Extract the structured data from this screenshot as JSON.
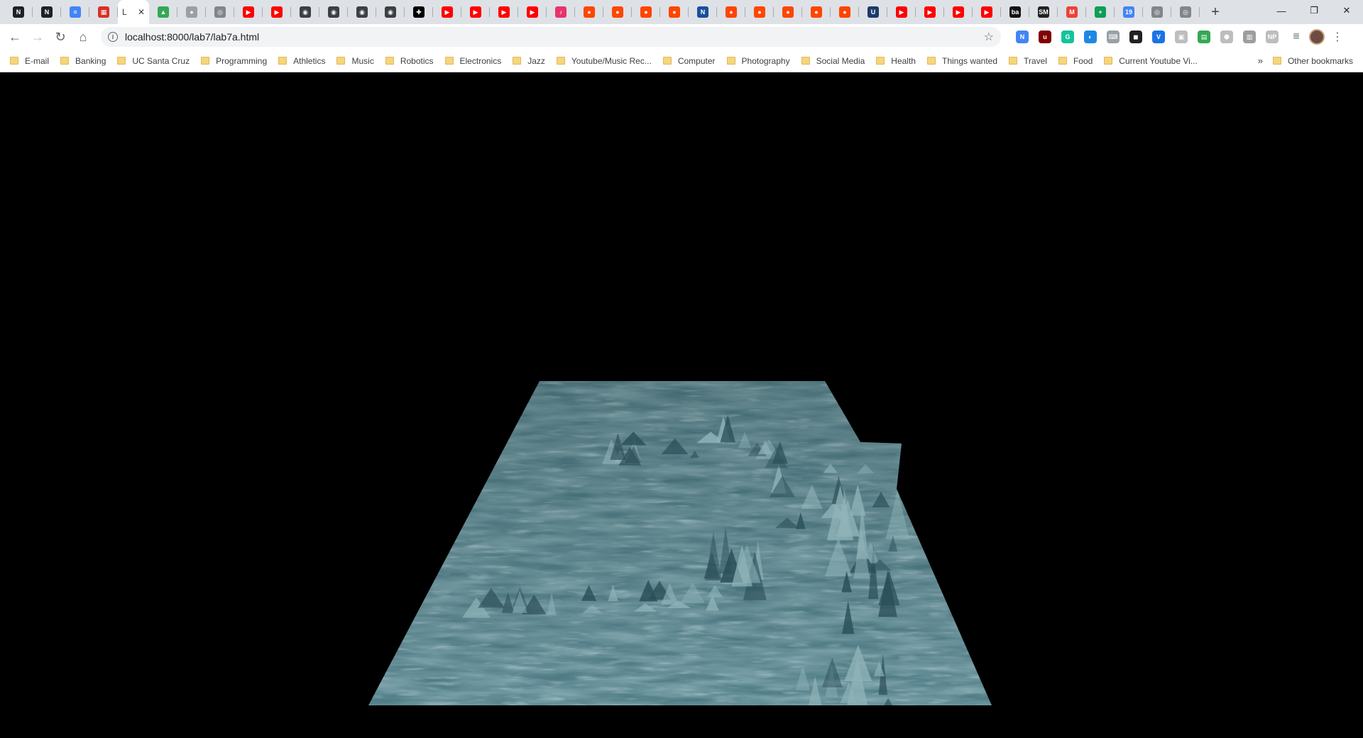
{
  "tabs": [
    {
      "icon": "notion-icon",
      "color": "#202124",
      "glyph": "N"
    },
    {
      "icon": "notion-icon",
      "color": "#202124",
      "glyph": "N"
    },
    {
      "icon": "docs-icon",
      "color": "#4285f4",
      "glyph": "≡"
    },
    {
      "icon": "calendar-icon",
      "color": "#d93025",
      "glyph": "▦"
    },
    {
      "active": true,
      "label": "L",
      "close": "✕"
    },
    {
      "icon": "drive-icon",
      "color": "#34a853",
      "glyph": "▲"
    },
    {
      "icon": "github-icon",
      "color": "#9aa0a6",
      "glyph": "●"
    },
    {
      "icon": "globe-icon",
      "color": "#80868b",
      "glyph": "◎"
    },
    {
      "icon": "youtube-icon",
      "color": "#ff0000",
      "glyph": "▶"
    },
    {
      "icon": "youtube-icon",
      "color": "#ff0000",
      "glyph": "▶"
    },
    {
      "icon": "camera-icon",
      "color": "#3c4043",
      "glyph": "◉"
    },
    {
      "icon": "camera-icon",
      "color": "#3c4043",
      "glyph": "◉"
    },
    {
      "icon": "camera-icon",
      "color": "#3c4043",
      "glyph": "◉"
    },
    {
      "icon": "camera-icon",
      "color": "#3c4043",
      "glyph": "◉"
    },
    {
      "icon": "plus-icon",
      "color": "#000000",
      "glyph": "✚"
    },
    {
      "icon": "youtube-icon",
      "color": "#ff0000",
      "glyph": "▶"
    },
    {
      "icon": "youtube-icon",
      "color": "#ff0000",
      "glyph": "▶"
    },
    {
      "icon": "youtube-icon",
      "color": "#ff0000",
      "glyph": "▶"
    },
    {
      "icon": "youtube-icon",
      "color": "#ff0000",
      "glyph": "▶"
    },
    {
      "icon": "music-icon",
      "color": "#e8336d",
      "glyph": "♪"
    },
    {
      "icon": "reddit-icon",
      "color": "#ff4500",
      "glyph": "●"
    },
    {
      "icon": "reddit-icon",
      "color": "#ff4500",
      "glyph": "●"
    },
    {
      "icon": "reddit-icon",
      "color": "#ff4500",
      "glyph": "●"
    },
    {
      "icon": "reddit-icon",
      "color": "#ff4500",
      "glyph": "●"
    },
    {
      "icon": "news-icon",
      "color": "#1a4f9c",
      "glyph": "N"
    },
    {
      "icon": "reddit-icon",
      "color": "#ff4500",
      "glyph": "●"
    },
    {
      "icon": "reddit-icon",
      "color": "#ff4500",
      "glyph": "●"
    },
    {
      "icon": "reddit-icon",
      "color": "#ff4500",
      "glyph": "●"
    },
    {
      "icon": "reddit-icon",
      "color": "#ff4500",
      "glyph": "●"
    },
    {
      "icon": "reddit-icon",
      "color": "#ff4500",
      "glyph": "●"
    },
    {
      "icon": "ucsc-icon",
      "color": "#1b3a6b",
      "glyph": "U"
    },
    {
      "icon": "youtube-icon",
      "color": "#ff0000",
      "glyph": "▶"
    },
    {
      "icon": "youtube-icon",
      "color": "#ff0000",
      "glyph": "▶"
    },
    {
      "icon": "youtube-icon",
      "color": "#ff0000",
      "glyph": "▶"
    },
    {
      "icon": "youtube-icon",
      "color": "#ff0000",
      "glyph": "▶"
    },
    {
      "icon": "behance-icon",
      "color": "#111111",
      "glyph": "ba"
    },
    {
      "icon": "sm-icon",
      "color": "#222222",
      "glyph": "SM"
    },
    {
      "icon": "gmail-icon",
      "color": "#ea4335",
      "glyph": "M"
    },
    {
      "icon": "sheets-plus-icon",
      "color": "#0f9d58",
      "glyph": "+"
    },
    {
      "icon": "calendar-19-icon",
      "color": "#4285f4",
      "glyph": "19"
    },
    {
      "icon": "globe-icon",
      "color": "#80868b",
      "glyph": "◎"
    },
    {
      "icon": "globe-icon",
      "color": "#80868b",
      "glyph": "◎"
    }
  ],
  "newtab": "+",
  "window": {
    "minimize": "—",
    "restore": "❐",
    "close": "✕"
  },
  "nav": {
    "back": "←",
    "forward": "→",
    "reload": "↻",
    "home": "⌂"
  },
  "address": {
    "info": "i",
    "url": "localhost:8000/lab7/lab7a.html",
    "star": "☆"
  },
  "extensions": [
    {
      "icon": "new-ext-icon",
      "color": "#4285f4",
      "glyph": "N"
    },
    {
      "icon": "ublock-icon",
      "color": "#800000",
      "glyph": "u"
    },
    {
      "icon": "grammarly-icon",
      "color": "#15c39a",
      "glyph": "G"
    },
    {
      "icon": "circle-ext-icon",
      "color": "#1e88e5",
      "glyph": "◐"
    },
    {
      "icon": "keyboard-ext-icon",
      "color": "#9aa0a6",
      "glyph": "⌨"
    },
    {
      "icon": "honey-ext-icon",
      "color": "#202124",
      "glyph": "◼"
    },
    {
      "icon": "v-ext-icon",
      "color": "#1a73e8",
      "glyph": "V"
    },
    {
      "icon": "gray-ext-icon",
      "color": "#bdbdbd",
      "glyph": "▣"
    },
    {
      "icon": "green-ext-icon",
      "color": "#34a853",
      "glyph": "▤"
    },
    {
      "icon": "shield-ext-icon",
      "color": "#bdbdbd",
      "glyph": "⬢"
    },
    {
      "icon": "chart-ext-icon",
      "color": "#9e9e9e",
      "glyph": "▥"
    },
    {
      "icon": "np-ext-icon",
      "color": "#bdbdbd",
      "glyph": "NP"
    }
  ],
  "toolbar_menu": {
    "playlist": "≡",
    "kebab": "⋮"
  },
  "bookmarks": [
    {
      "label": "E-mail"
    },
    {
      "label": "Banking"
    },
    {
      "label": "UC Santa Cruz"
    },
    {
      "label": "Programming"
    },
    {
      "label": "Athletics"
    },
    {
      "label": "Music"
    },
    {
      "label": "Robotics"
    },
    {
      "label": "Electronics"
    },
    {
      "label": "Jazz"
    },
    {
      "label": "Youtube/Music Rec..."
    },
    {
      "label": "Computer"
    },
    {
      "label": "Photography"
    },
    {
      "label": "Social Media"
    },
    {
      "label": "Health"
    },
    {
      "label": "Things wanted"
    },
    {
      "label": "Travel"
    },
    {
      "label": "Food"
    },
    {
      "label": "Current Youtube Vi..."
    }
  ],
  "bookmarks_overflow": "»",
  "other_bookmarks": "Other bookmarks",
  "scene": {
    "background": "#000000",
    "water_light": "#8fb3b8",
    "water_mid": "#4e7b85",
    "water_dark": "#2a4d57"
  }
}
